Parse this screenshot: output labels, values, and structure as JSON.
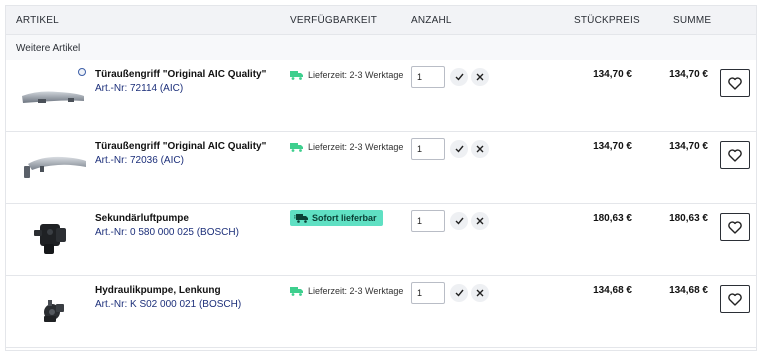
{
  "header": {
    "col_article": "ARTIKEL",
    "col_availability": "VERFÜGBARKEIT",
    "col_quantity": "ANZAHL",
    "col_unit_price": "STÜCKPREIS",
    "col_sum": "SUMME"
  },
  "group_label": "Weitere Artikel",
  "colors": {
    "header_bg": "#f2f3f6",
    "accent_green": "#3ecf8e",
    "badge_bg": "#5fe0c3",
    "link_blue": "#1c2f7a"
  },
  "items": [
    {
      "name": "Türaußengriff \"Original AIC Quality\"",
      "part_no": "Art.-Nr: 72114 (AIC)",
      "availability": "Lieferzeit: 2-3 Werktage",
      "availability_icon": "truck-icon",
      "in_stock": false,
      "quantity": "1",
      "unit_price": "134,70 €",
      "sum": "134,70 €",
      "image": "door-handle-long"
    },
    {
      "name": "Türaußengriff \"Original AIC Quality\"",
      "part_no": "Art.-Nr: 72036 (AIC)",
      "availability": "Lieferzeit: 2-3 Werktage",
      "availability_icon": "truck-icon",
      "in_stock": false,
      "quantity": "1",
      "unit_price": "134,70 €",
      "sum": "134,70 €",
      "image": "door-handle-curved"
    },
    {
      "name": "Sekundärluftpumpe",
      "part_no": "Art.-Nr: 0 580 000 025 (BOSCH)",
      "availability": "Sofort lieferbar",
      "availability_icon": "fast-truck-icon",
      "in_stock": true,
      "quantity": "1",
      "unit_price": "180,63 €",
      "sum": "180,63 €",
      "image": "air-pump"
    },
    {
      "name": "Hydraulikpumpe, Lenkung",
      "part_no": "Art.-Nr: K S02 000 021 (BOSCH)",
      "availability": "Lieferzeit: 2-3 Werktage",
      "availability_icon": "truck-icon",
      "in_stock": false,
      "quantity": "1",
      "unit_price": "134,68 €",
      "sum": "134,68 €",
      "image": "hydraulic-pump"
    }
  ]
}
